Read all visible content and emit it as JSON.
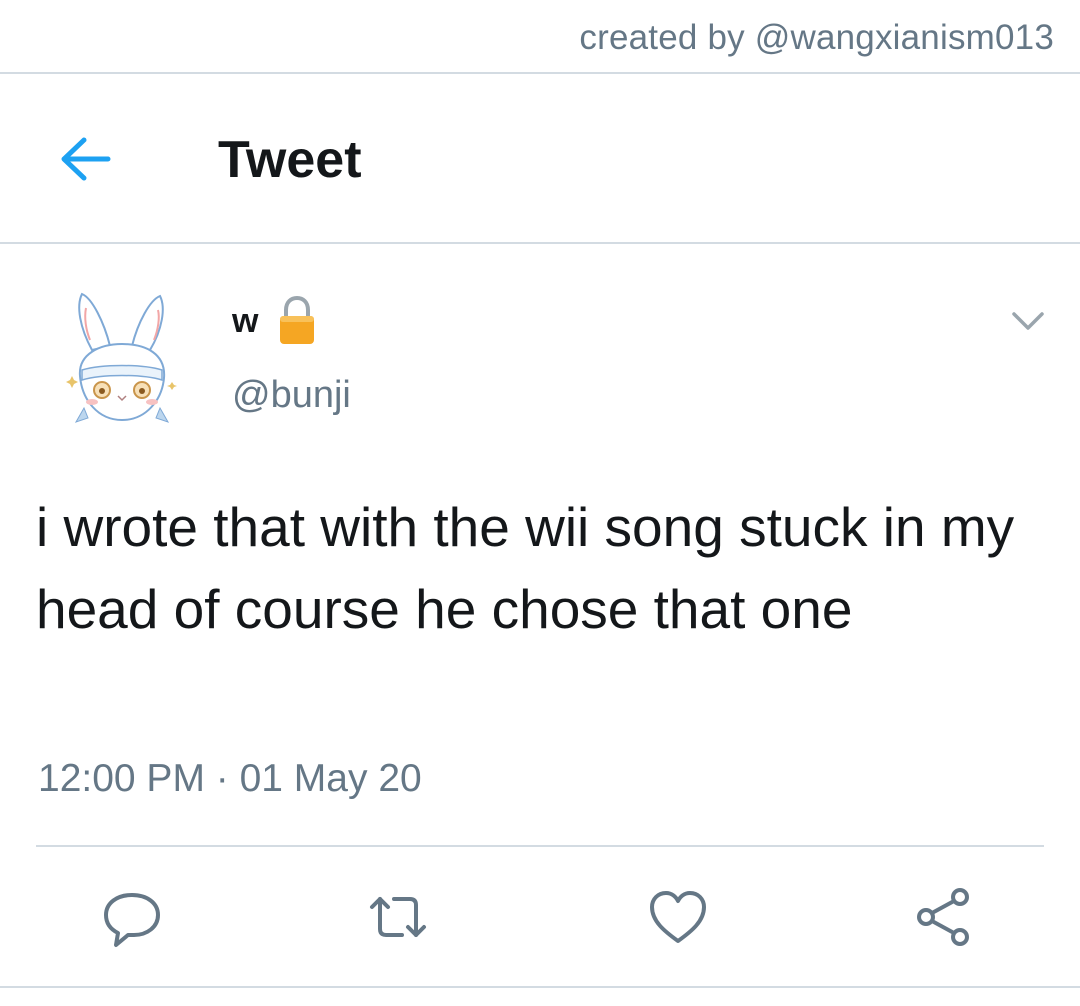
{
  "credit": "created by @wangxianism013",
  "header": {
    "title": "Tweet",
    "back_icon": "arrow-left-icon"
  },
  "tweet": {
    "display_name": "w",
    "handle": "@bunji",
    "protected_icon": "lock-icon",
    "text": "i wrote that with the wii song stuck in my head of course he chose that one",
    "timestamp": "12:00 PM · 01 May 20",
    "more_icon": "chevron-down-icon"
  },
  "actions": [
    {
      "name": "reply",
      "icon": "reply-bubble-icon"
    },
    {
      "name": "retweet",
      "icon": "retweet-icon"
    },
    {
      "name": "like",
      "icon": "heart-icon"
    },
    {
      "name": "share",
      "icon": "share-icon"
    }
  ],
  "colors": {
    "accent": "#1da1f2",
    "secondary_text": "#657786",
    "primary_text": "#14171a",
    "divider": "#d3dbe2",
    "lock": "#f5a623"
  }
}
